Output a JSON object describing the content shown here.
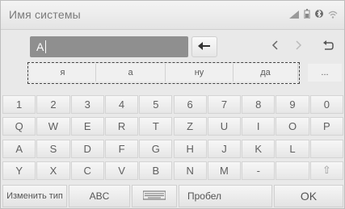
{
  "header": {
    "title": "Имя системы",
    "status_icons": [
      "signal-icon",
      "battery-icon",
      "bluetooth-icon",
      "wifi-icon"
    ]
  },
  "input": {
    "value": "A"
  },
  "controls": {
    "backspace_icon": "backspace-arrow-icon",
    "cursor_left_icon": "chevron-left-icon",
    "cursor_right_icon": "chevron-right-icon",
    "back_icon": "return-icon"
  },
  "suggestions": {
    "items": [
      "я",
      "а",
      "ну",
      "да"
    ],
    "more_label": "..."
  },
  "keyboard": {
    "rows": [
      [
        "1",
        "2",
        "3",
        "4",
        "5",
        "6",
        "7",
        "8",
        "9",
        "0"
      ],
      [
        "Q",
        "W",
        "E",
        "R",
        "T",
        "Z",
        "U",
        "I",
        "O",
        "P"
      ],
      [
        "A",
        "S",
        "D",
        "F",
        "G",
        "H",
        "J",
        "K",
        "L",
        ""
      ],
      [
        "Y",
        "X",
        "C",
        "V",
        "B",
        "N",
        "M",
        "-",
        "",
        "⇧"
      ]
    ]
  },
  "bottom": {
    "change_type": "Изменить тип",
    "abc": "ABC",
    "keyboard_icon": "keyboard-icon",
    "space": "Пробел",
    "ok": "OK"
  }
}
